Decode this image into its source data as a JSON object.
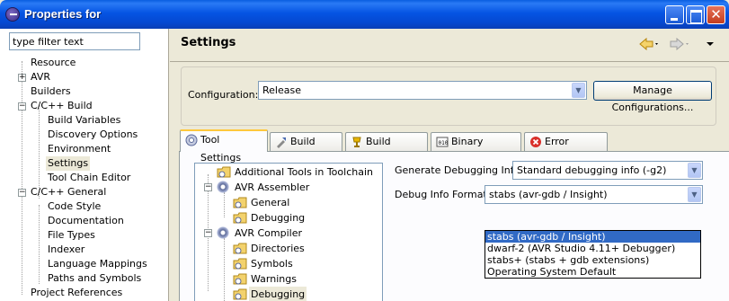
{
  "window": {
    "title": "Properties for"
  },
  "filter": {
    "value": "type filter text"
  },
  "left_tree": [
    {
      "label": "Resource"
    },
    {
      "label": "AVR"
    },
    {
      "label": "Builders"
    },
    {
      "label": "C/C++ Build"
    },
    {
      "label": "Build Variables"
    },
    {
      "label": "Discovery Options"
    },
    {
      "label": "Environment"
    },
    {
      "label": "Settings"
    },
    {
      "label": "Tool Chain Editor"
    },
    {
      "label": "C/C++ General"
    },
    {
      "label": "Code Style"
    },
    {
      "label": "Documentation"
    },
    {
      "label": "File Types"
    },
    {
      "label": "Indexer"
    },
    {
      "label": "Language Mappings"
    },
    {
      "label": "Paths and Symbols"
    },
    {
      "label": "Project References"
    }
  ],
  "header": {
    "title": "Settings"
  },
  "config": {
    "label": "Configuration:",
    "value": "Release",
    "manage_button": "Manage Configurations..."
  },
  "tabs": [
    {
      "label": "Tool Settings",
      "icon": "tool-settings-icon"
    },
    {
      "label": "Build Steps",
      "icon": "build-steps-icon"
    },
    {
      "label": "Build Artifact",
      "icon": "build-artifact-icon"
    },
    {
      "label": "Binary Parsers",
      "icon": "binary-parsers-icon"
    },
    {
      "label": "Error Parsers",
      "icon": "error-parsers-icon"
    }
  ],
  "tool_tree": [
    {
      "label": "Additional Tools in Toolchain"
    },
    {
      "label": "AVR Assembler"
    },
    {
      "label": "General"
    },
    {
      "label": "Debugging"
    },
    {
      "label": "AVR Compiler"
    },
    {
      "label": "Directories"
    },
    {
      "label": "Symbols"
    },
    {
      "label": "Warnings"
    },
    {
      "label": "Debugging"
    }
  ],
  "options": {
    "gen_debug_label": "Generate Debugging Info",
    "gen_debug_value": "Standard debugging info (-g2)",
    "format_label": "Debug Info Format",
    "format_value": "stabs (avr-gdb / Insight)",
    "format_options": [
      "stabs (avr-gdb / Insight)",
      "dwarf-2 (AVR Studio 4.11+ Debugger)",
      "stabs+ (stabs + gdb extensions)",
      "Operating System Default"
    ]
  },
  "colors": {
    "titlebar": "#0554e3",
    "selection": "#316ac5",
    "tab_highlight": "#ffc83c"
  }
}
